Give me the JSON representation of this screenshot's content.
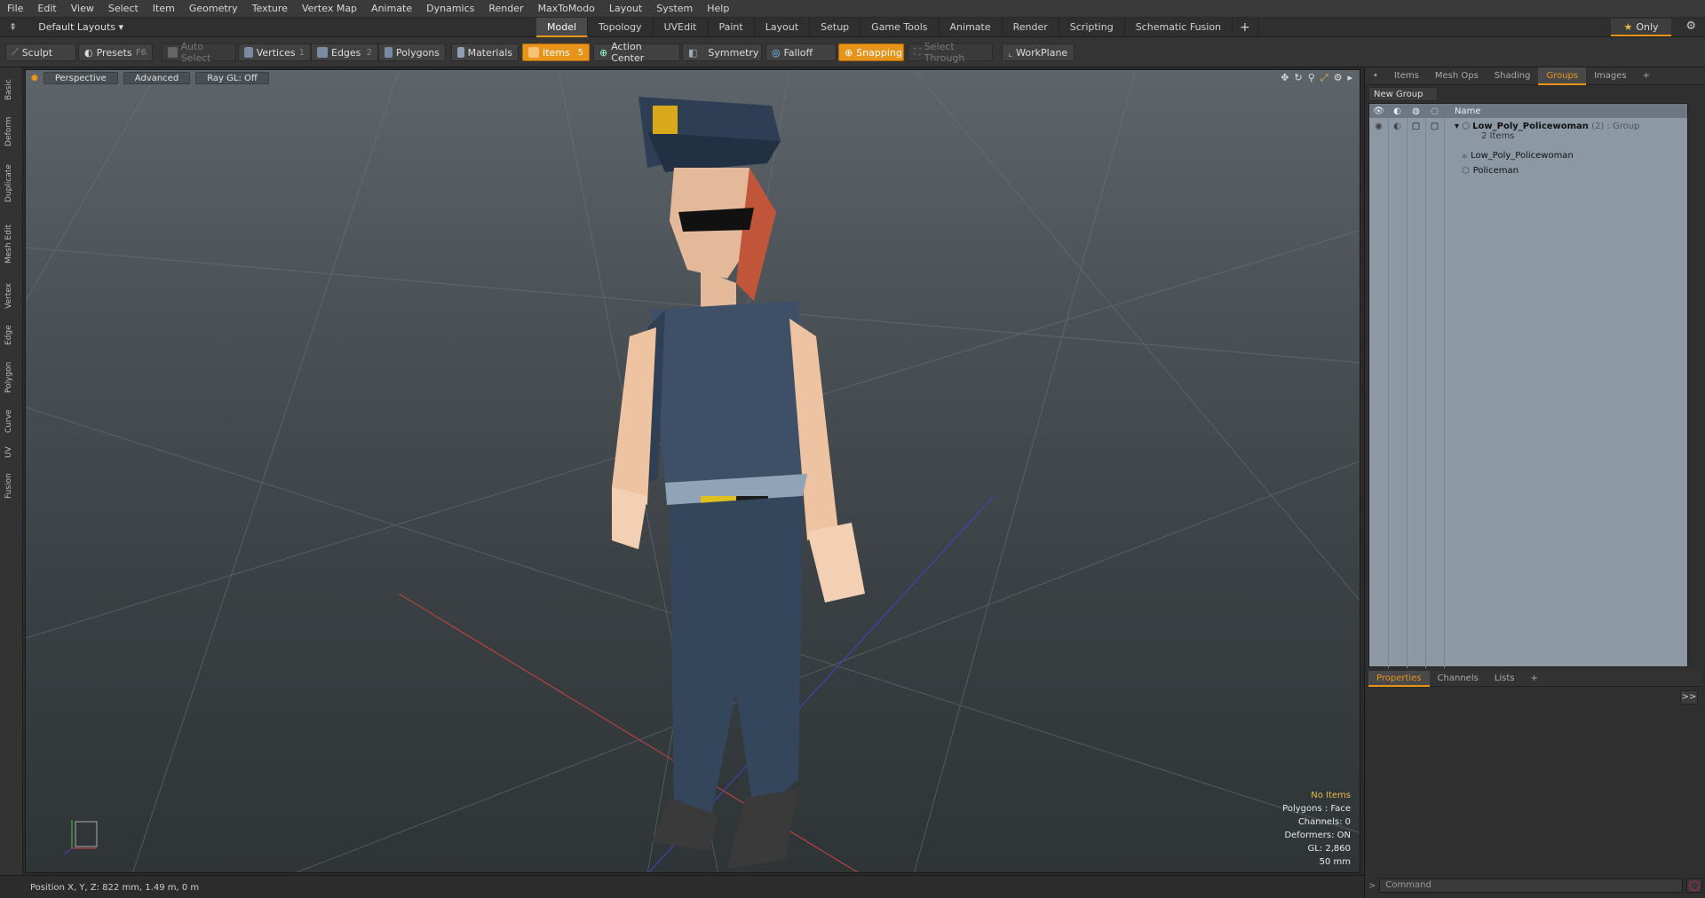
{
  "menu": [
    "File",
    "Edit",
    "View",
    "Select",
    "Item",
    "Geometry",
    "Texture",
    "Vertex Map",
    "Animate",
    "Dynamics",
    "Render",
    "MaxToModo",
    "Layout",
    "System",
    "Help"
  ],
  "layout": {
    "name": "Default Layouts",
    "tabs": [
      "Model",
      "Topology",
      "UVEdit",
      "Paint",
      "Layout",
      "Setup",
      "Game Tools",
      "Animate",
      "Render",
      "Scripting",
      "Schematic Fusion"
    ],
    "active_tab": "Model",
    "plus": "+",
    "only_label": "Only"
  },
  "toolbar": {
    "sculpt": "Sculpt",
    "presets": "Presets",
    "presets_key": "F6",
    "auto_select": "Auto Select",
    "vertices": "Vertices",
    "vertices_key": "1",
    "edges": "Edges",
    "edges_key": "2",
    "polygons": "Polygons",
    "materials": "Materials",
    "items": "Items",
    "items_key": "5",
    "action_center": "Action Center",
    "symmetry": "Symmetry",
    "falloff": "Falloff",
    "snapping": "Snapping",
    "select_through": "Select Through",
    "workplane": "WorkPlane"
  },
  "left_tabs": [
    "Basic",
    "Deform",
    "Duplicate",
    "Mesh Edit",
    "Vertex",
    "Edge",
    "Polygon",
    "Curve",
    "UV",
    "Fusion"
  ],
  "viewport": {
    "view": "Perspective",
    "shading": "Advanced",
    "raygl": "Ray GL: Off",
    "info": {
      "selection": "No Items",
      "polygons": "Polygons : Face",
      "channels": "Channels: 0",
      "deformers": "Deformers: ON",
      "gl": "GL: 2,860",
      "scale": "50 mm"
    }
  },
  "status": {
    "position": "Position X, Y, Z:   822 mm, 1.49 m, 0 m"
  },
  "right_panel": {
    "tabs": [
      "Items",
      "Mesh Ops",
      "Shading",
      "Groups",
      "Images"
    ],
    "active_tab": "Groups",
    "new_group": "New Group",
    "name_header": "Name",
    "group_name": "Low_Poly_Policewoman",
    "group_suffix": "(2) : Group",
    "group_count": "2 Items",
    "children": [
      "Low_Poly_Policewoman",
      "Policeman"
    ]
  },
  "bottom_panel": {
    "tabs": [
      "Properties",
      "Channels",
      "Lists"
    ],
    "active_tab": "Properties",
    "arrow": ">>",
    "command_placeholder": "Command"
  },
  "colors": {
    "accent": "#e8941a",
    "viewport_top": "#5d646a",
    "viewport_bottom": "#2f3436",
    "group_list_bg": "#8c99a5"
  }
}
